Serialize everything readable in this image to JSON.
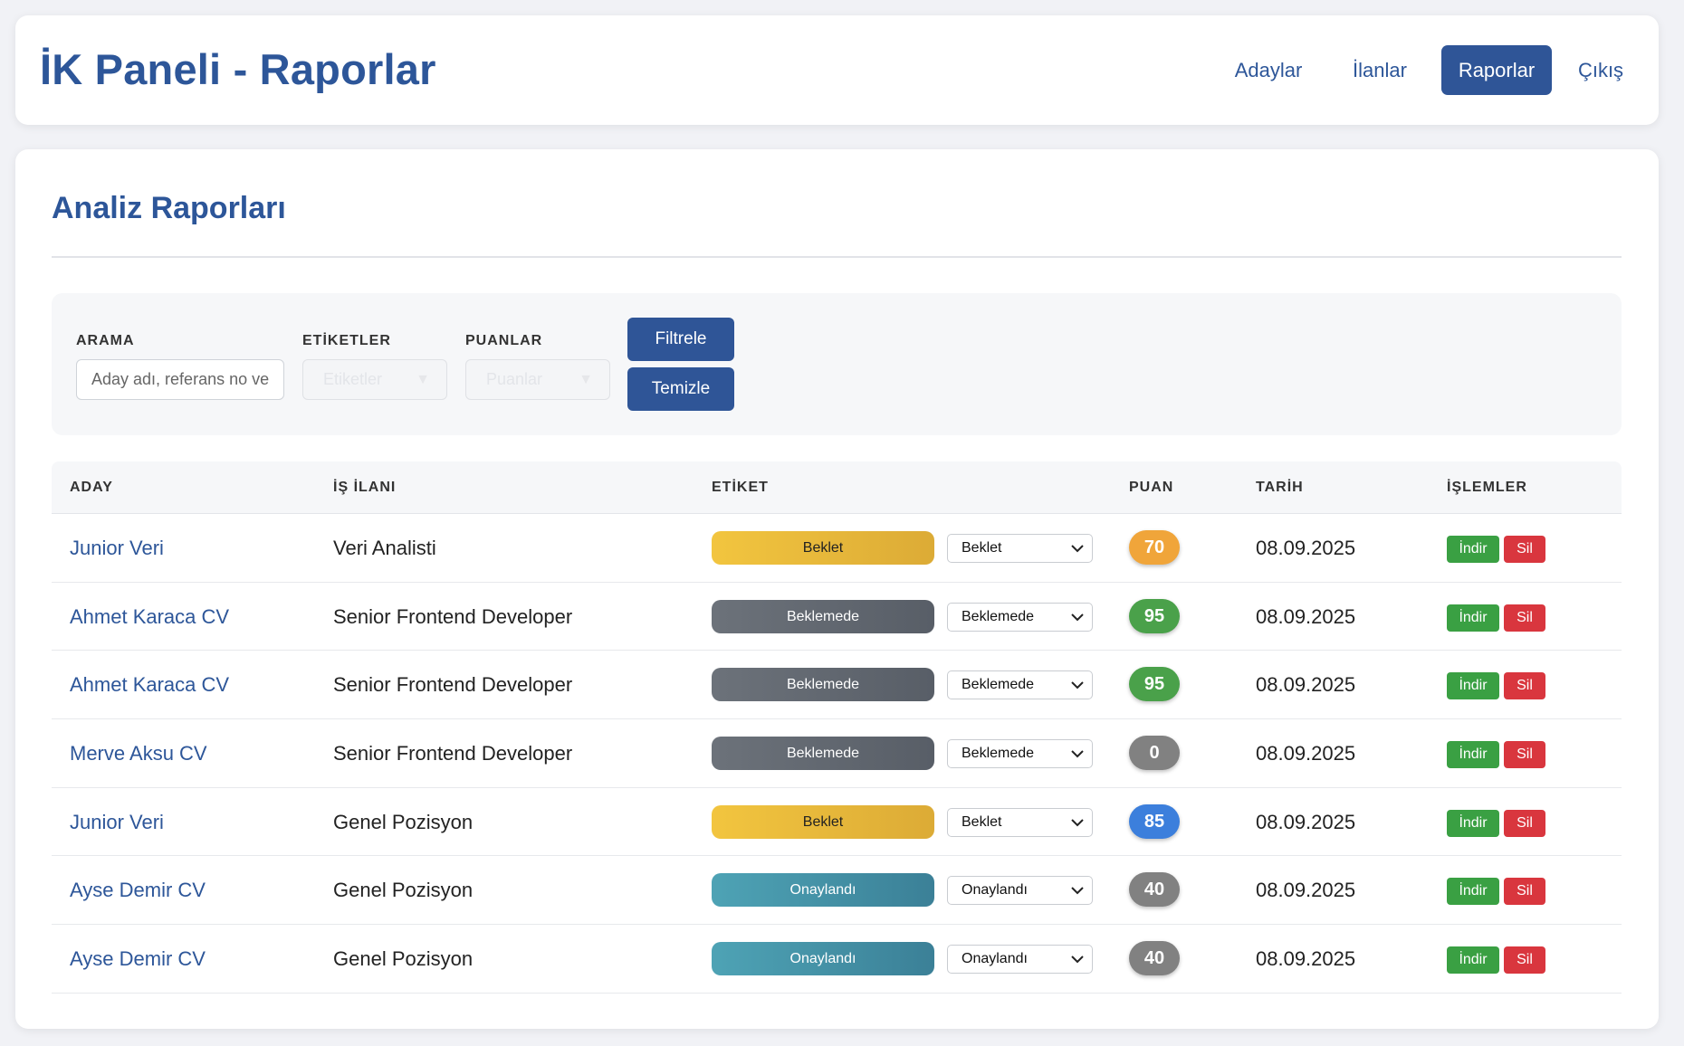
{
  "header": {
    "title": "İK Paneli - Raporlar",
    "nav": [
      "Adaylar",
      "İlanlar",
      "Raporlar",
      "Çıkış"
    ],
    "active_nav": "Raporlar"
  },
  "main": {
    "title": "Analiz Raporları",
    "filters": {
      "search_label": "ARAMA",
      "search_placeholder": "Aday adı, referans no ve",
      "tags_label": "ETİKETLER",
      "tags_placeholder": "Etiketler",
      "scores_label": "PUANLAR",
      "scores_placeholder": "Puanlar",
      "filter_button": "Filtrele",
      "clear_button": "Temizle"
    },
    "table": {
      "columns": [
        "ADAY",
        "İŞ İLANI",
        "ETİKET",
        "PUAN",
        "TARİH",
        "İŞLEMLER"
      ],
      "download_label": "İndir",
      "delete_label": "Sil",
      "rows": [
        {
          "candidate": "Junior Veri",
          "job": "Veri Analisti",
          "tag": "Beklet",
          "tag_select": "Beklet",
          "score": "70",
          "date": "08.09.2025"
        },
        {
          "candidate": "Ahmet Karaca CV",
          "job": "Senior Frontend Developer",
          "tag": "Beklemede",
          "tag_select": "Beklemede",
          "score": "95",
          "date": "08.09.2025"
        },
        {
          "candidate": "Ahmet Karaca CV",
          "job": "Senior Frontend Developer",
          "tag": "Beklemede",
          "tag_select": "Beklemede",
          "score": "95",
          "date": "08.09.2025"
        },
        {
          "candidate": "Merve Aksu CV",
          "job": "Senior Frontend Developer",
          "tag": "Beklemede",
          "tag_select": "Beklemede",
          "score": "0",
          "date": "08.09.2025"
        },
        {
          "candidate": "Junior Veri",
          "job": "Genel Pozisyon",
          "tag": "Beklet",
          "tag_select": "Beklet",
          "score": "85",
          "date": "08.09.2025"
        },
        {
          "candidate": "Ayse Demir CV",
          "job": "Genel Pozisyon",
          "tag": "Onaylandı",
          "tag_select": "Onaylandı",
          "score": "40",
          "date": "08.09.2025"
        },
        {
          "candidate": "Ayse Demir CV",
          "job": "Genel Pozisyon",
          "tag": "Onaylandı",
          "tag_select": "Onaylandı",
          "score": "40",
          "date": "08.09.2025"
        }
      ]
    }
  },
  "colors": {
    "primary": "#2f5597",
    "tag_beklet": "#f2c53f",
    "tag_beklemede": "#646a72",
    "tag_onaylandi": "#4596aa",
    "score_orange": "#f0a53a",
    "score_green": "#4aa14a",
    "score_blue": "#3c7fdc",
    "score_gray": "#818181",
    "download": "#3aa043",
    "delete": "#d9363e"
  }
}
